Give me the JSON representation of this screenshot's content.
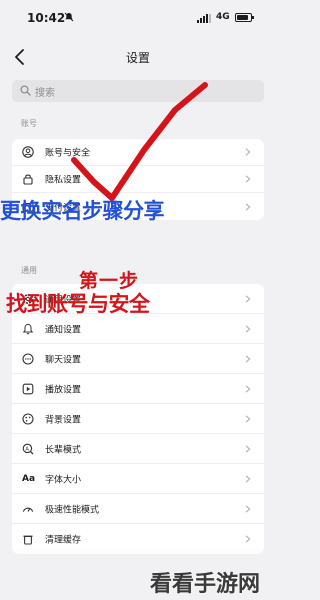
{
  "status_bar": {
    "time": "10:42",
    "network": "4G"
  },
  "nav": {
    "title": "设置"
  },
  "search": {
    "placeholder": "搜索"
  },
  "sections": {
    "account": {
      "label": "账号",
      "items": [
        {
          "label": "账号与安全",
          "icon": "account-icon"
        },
        {
          "label": "隐私设置",
          "icon": "privacy-icon"
        },
        {
          "label": "支付设置",
          "icon": "payment-icon"
        }
      ]
    },
    "general": {
      "label": "通用",
      "items": [
        {
          "label": "通用设置",
          "icon": "gear-icon"
        },
        {
          "label": "通知设置",
          "icon": "bell-icon"
        },
        {
          "label": "聊天设置",
          "icon": "chat-icon"
        },
        {
          "label": "播放设置",
          "icon": "play-icon"
        },
        {
          "label": "背景设置",
          "icon": "background-icon"
        },
        {
          "label": "长辈模式",
          "icon": "elder-mode-icon"
        },
        {
          "label": "字体大小",
          "icon": "font-size-icon"
        },
        {
          "label": "极速性能模式",
          "icon": "performance-icon"
        },
        {
          "label": "清理缓存",
          "icon": "clear-cache-icon"
        }
      ]
    }
  },
  "overlay": {
    "title": "更换实名步骤分享",
    "step": "第一步",
    "desc": "找到账号与安全"
  },
  "watermark": "看看手游网",
  "colors": {
    "overlay_blue": "#2251d6",
    "overlay_red": "#d4141a",
    "background": "#f1f1f3"
  }
}
